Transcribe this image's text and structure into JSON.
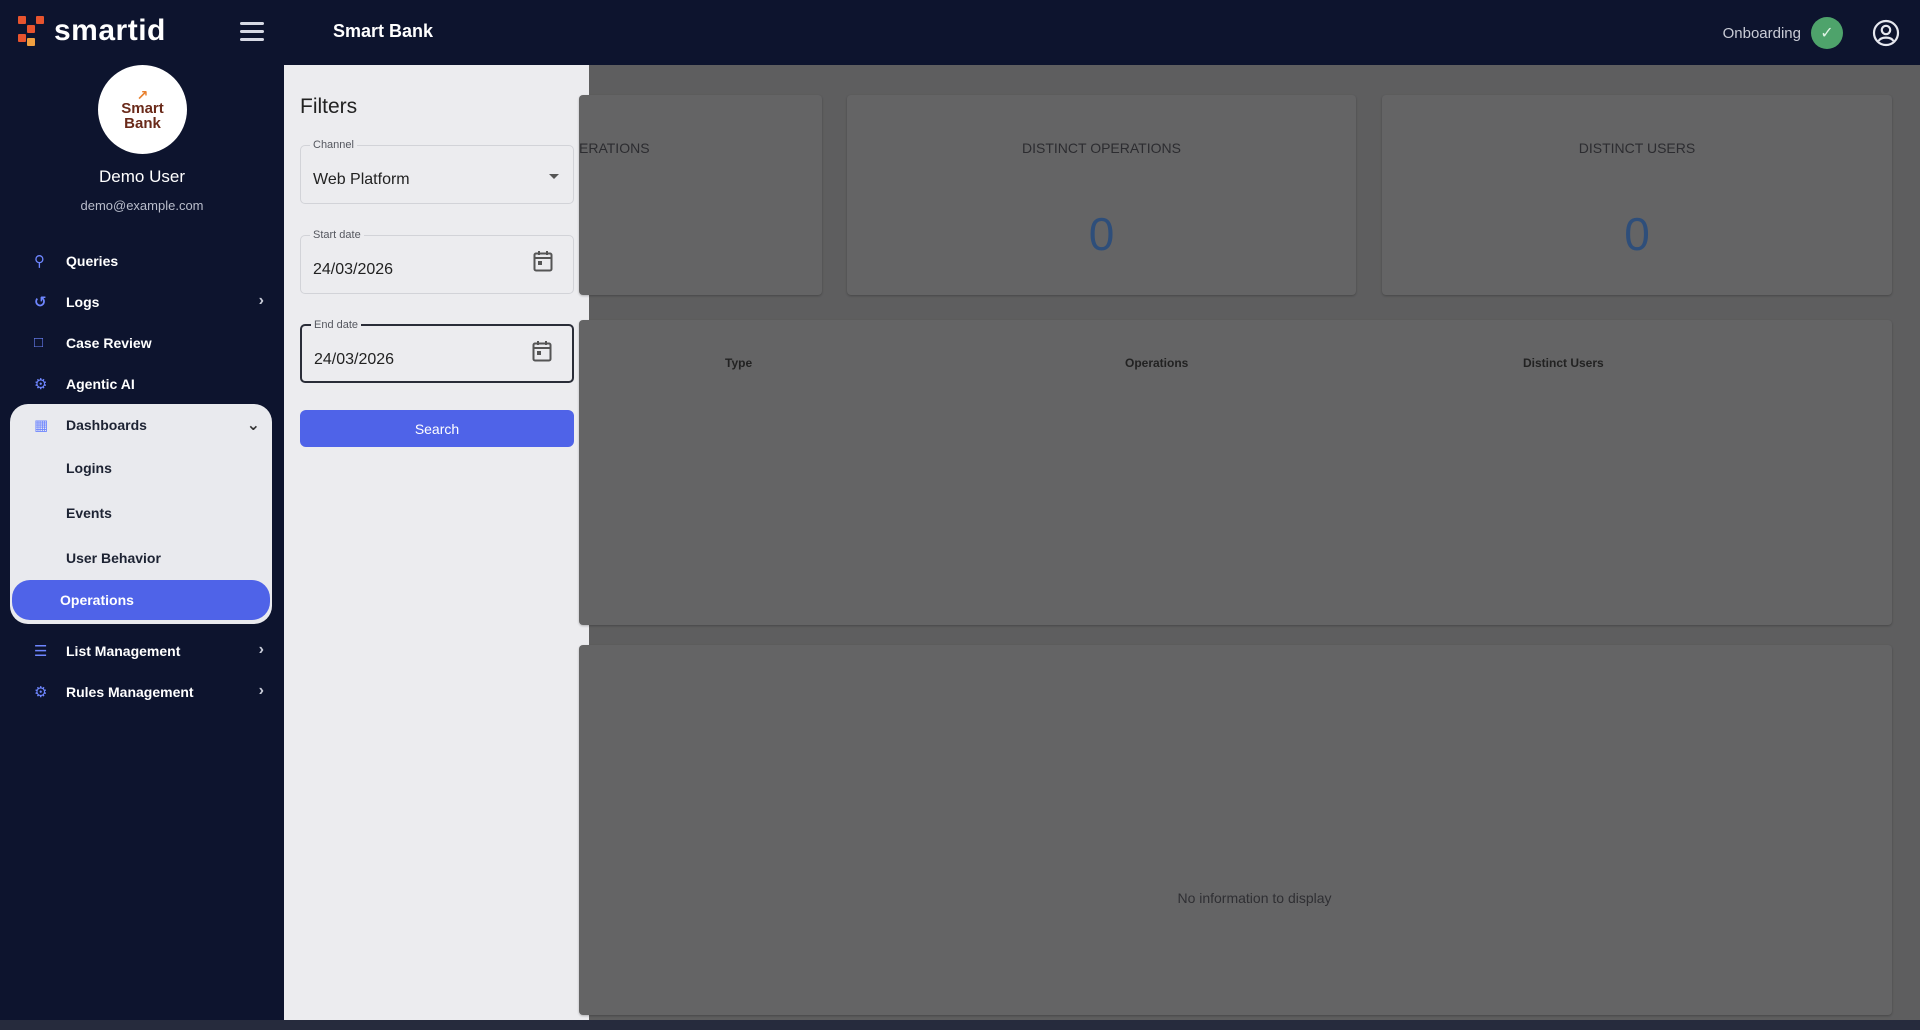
{
  "header": {
    "logo_text": "smartid",
    "app_title": "Smart Bank",
    "onboarding_label": "Onboarding"
  },
  "profile": {
    "avatar_line1": "Smart",
    "avatar_line2": "Bank",
    "name": "Demo User",
    "email": "demo@example.com"
  },
  "sidebar": {
    "items": [
      {
        "label": "Queries"
      },
      {
        "label": "Logs"
      },
      {
        "label": "Case Review"
      },
      {
        "label": "Agentic AI"
      },
      {
        "label": "Dashboards"
      }
    ],
    "dashboards_sub": [
      "Logins",
      "Events",
      "User Behavior",
      "Operations"
    ],
    "after": [
      {
        "label": "List Management"
      },
      {
        "label": "Rules Management"
      }
    ]
  },
  "filters": {
    "title": "Filters",
    "channel_label": "Channel",
    "channel_value": "Web Platform",
    "start_label": "Start date",
    "start_value": "24/03/2026",
    "end_label": "End date",
    "end_value": "24/03/2026",
    "search_label": "Search"
  },
  "main": {
    "card1_title_partial": "ERATIONS",
    "card2_title": "DISTINCT OPERATIONS",
    "card2_value": "0",
    "card3_title": "DISTINCT USERS",
    "card3_value": "0",
    "table_headers": [
      "Type",
      "Operations",
      "Distinct Users"
    ],
    "empty_message": "No information to display"
  },
  "colors": {
    "accent": "#4f63e8",
    "sidebar_bg": "#0d142e",
    "onboarding_ok": "#4ea36b"
  }
}
